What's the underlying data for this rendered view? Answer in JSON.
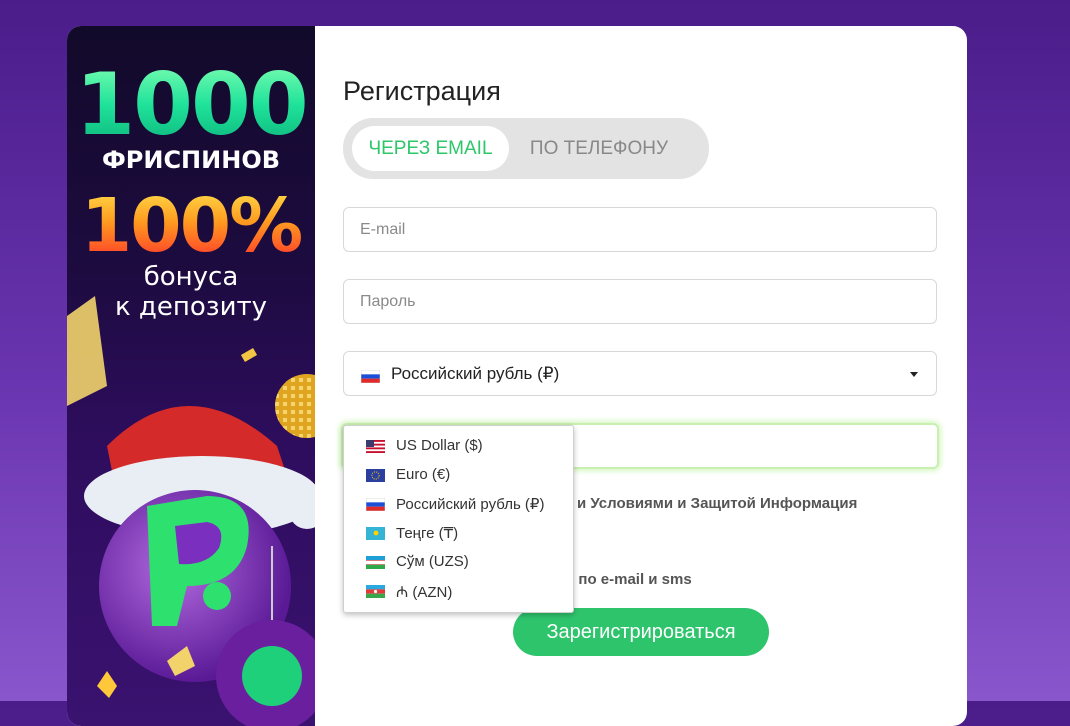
{
  "promo": {
    "line1": "1000",
    "line2": "ФРИСПИНОВ",
    "line3": "100%",
    "line4": "бонуса",
    "line5": "к депозиту"
  },
  "form": {
    "title": "Регистрация",
    "tabs": [
      {
        "label": "ЧЕРЕЗ EMAIL",
        "active": true
      },
      {
        "label": "ПО ТЕЛЕФОНУ",
        "active": false
      }
    ],
    "email_placeholder": "E-mail",
    "password_placeholder": "Пароль",
    "currency_selected": "Российский рубль (₽)",
    "agree_text": "и Условиями и Защитой Информация",
    "spam_text": "и по e-mail и sms",
    "submit_label": "Зарегистрироваться"
  },
  "currency_options": [
    {
      "label": "US Dollar ($)",
      "flag": "us-flag-icon"
    },
    {
      "label": "Euro (€)",
      "flag": "eu-flag-icon"
    },
    {
      "label": "Российский рубль (₽)",
      "flag": "ru-flag-icon"
    },
    {
      "label": "Теңге (₸)",
      "flag": "kz-flag-icon"
    },
    {
      "label": "Сўм (UZS)",
      "flag": "uz-flag-icon"
    },
    {
      "label": "₼ (AZN)",
      "flag": "az-flag-icon"
    }
  ],
  "colors": {
    "accent_green": "#2ec46c",
    "background_purple": "#5a2a9c"
  }
}
